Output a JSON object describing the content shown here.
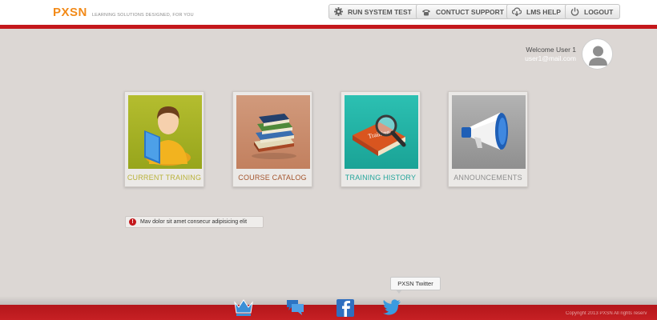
{
  "header": {
    "logo": "PXSN",
    "tagline": "LEARNING SOLUTIONS DESIGNED, FOR YOU",
    "buttons": [
      {
        "label": "RUN SYSTEM TEST",
        "icon": "gear-icon"
      },
      {
        "label": "CONTUCT SUPPORT",
        "icon": "phone-icon"
      },
      {
        "label": "LMS HELP",
        "icon": "cloud-download-icon"
      },
      {
        "label": "LOGOUT",
        "icon": "power-icon"
      }
    ]
  },
  "user": {
    "welcome": "Welcome User 1",
    "email": "user1@mail.com"
  },
  "tiles": [
    {
      "label": "CURRENT TRAINING",
      "color": "#b9b23a",
      "bg": "#a9b521"
    },
    {
      "label": "COURSE CATALOG",
      "color": "#a4542c",
      "bg": "#c98b6c"
    },
    {
      "label": "TRAINING HISTORY",
      "color": "#23a59b",
      "bg": "#23b2a4",
      "book_text": "Training"
    },
    {
      "label": "ANNOUNCEMENTS",
      "color": "#8f8f8f",
      "bg": "#9a9a9a"
    }
  ],
  "alert": {
    "icon": "!",
    "text": "Mav dolor sit amet consecur adipisicing elit"
  },
  "tooltip": "PXSN Twitter",
  "footer": {
    "copyright": "Copyright 2013 PXSN All rights reserv",
    "social": [
      "crown-icon",
      "chat-icon",
      "facebook-icon",
      "twitter-icon"
    ]
  },
  "colors": {
    "accent": "#c4171b",
    "logo": "#f28a18",
    "social_blue": "#3a8fd6"
  }
}
